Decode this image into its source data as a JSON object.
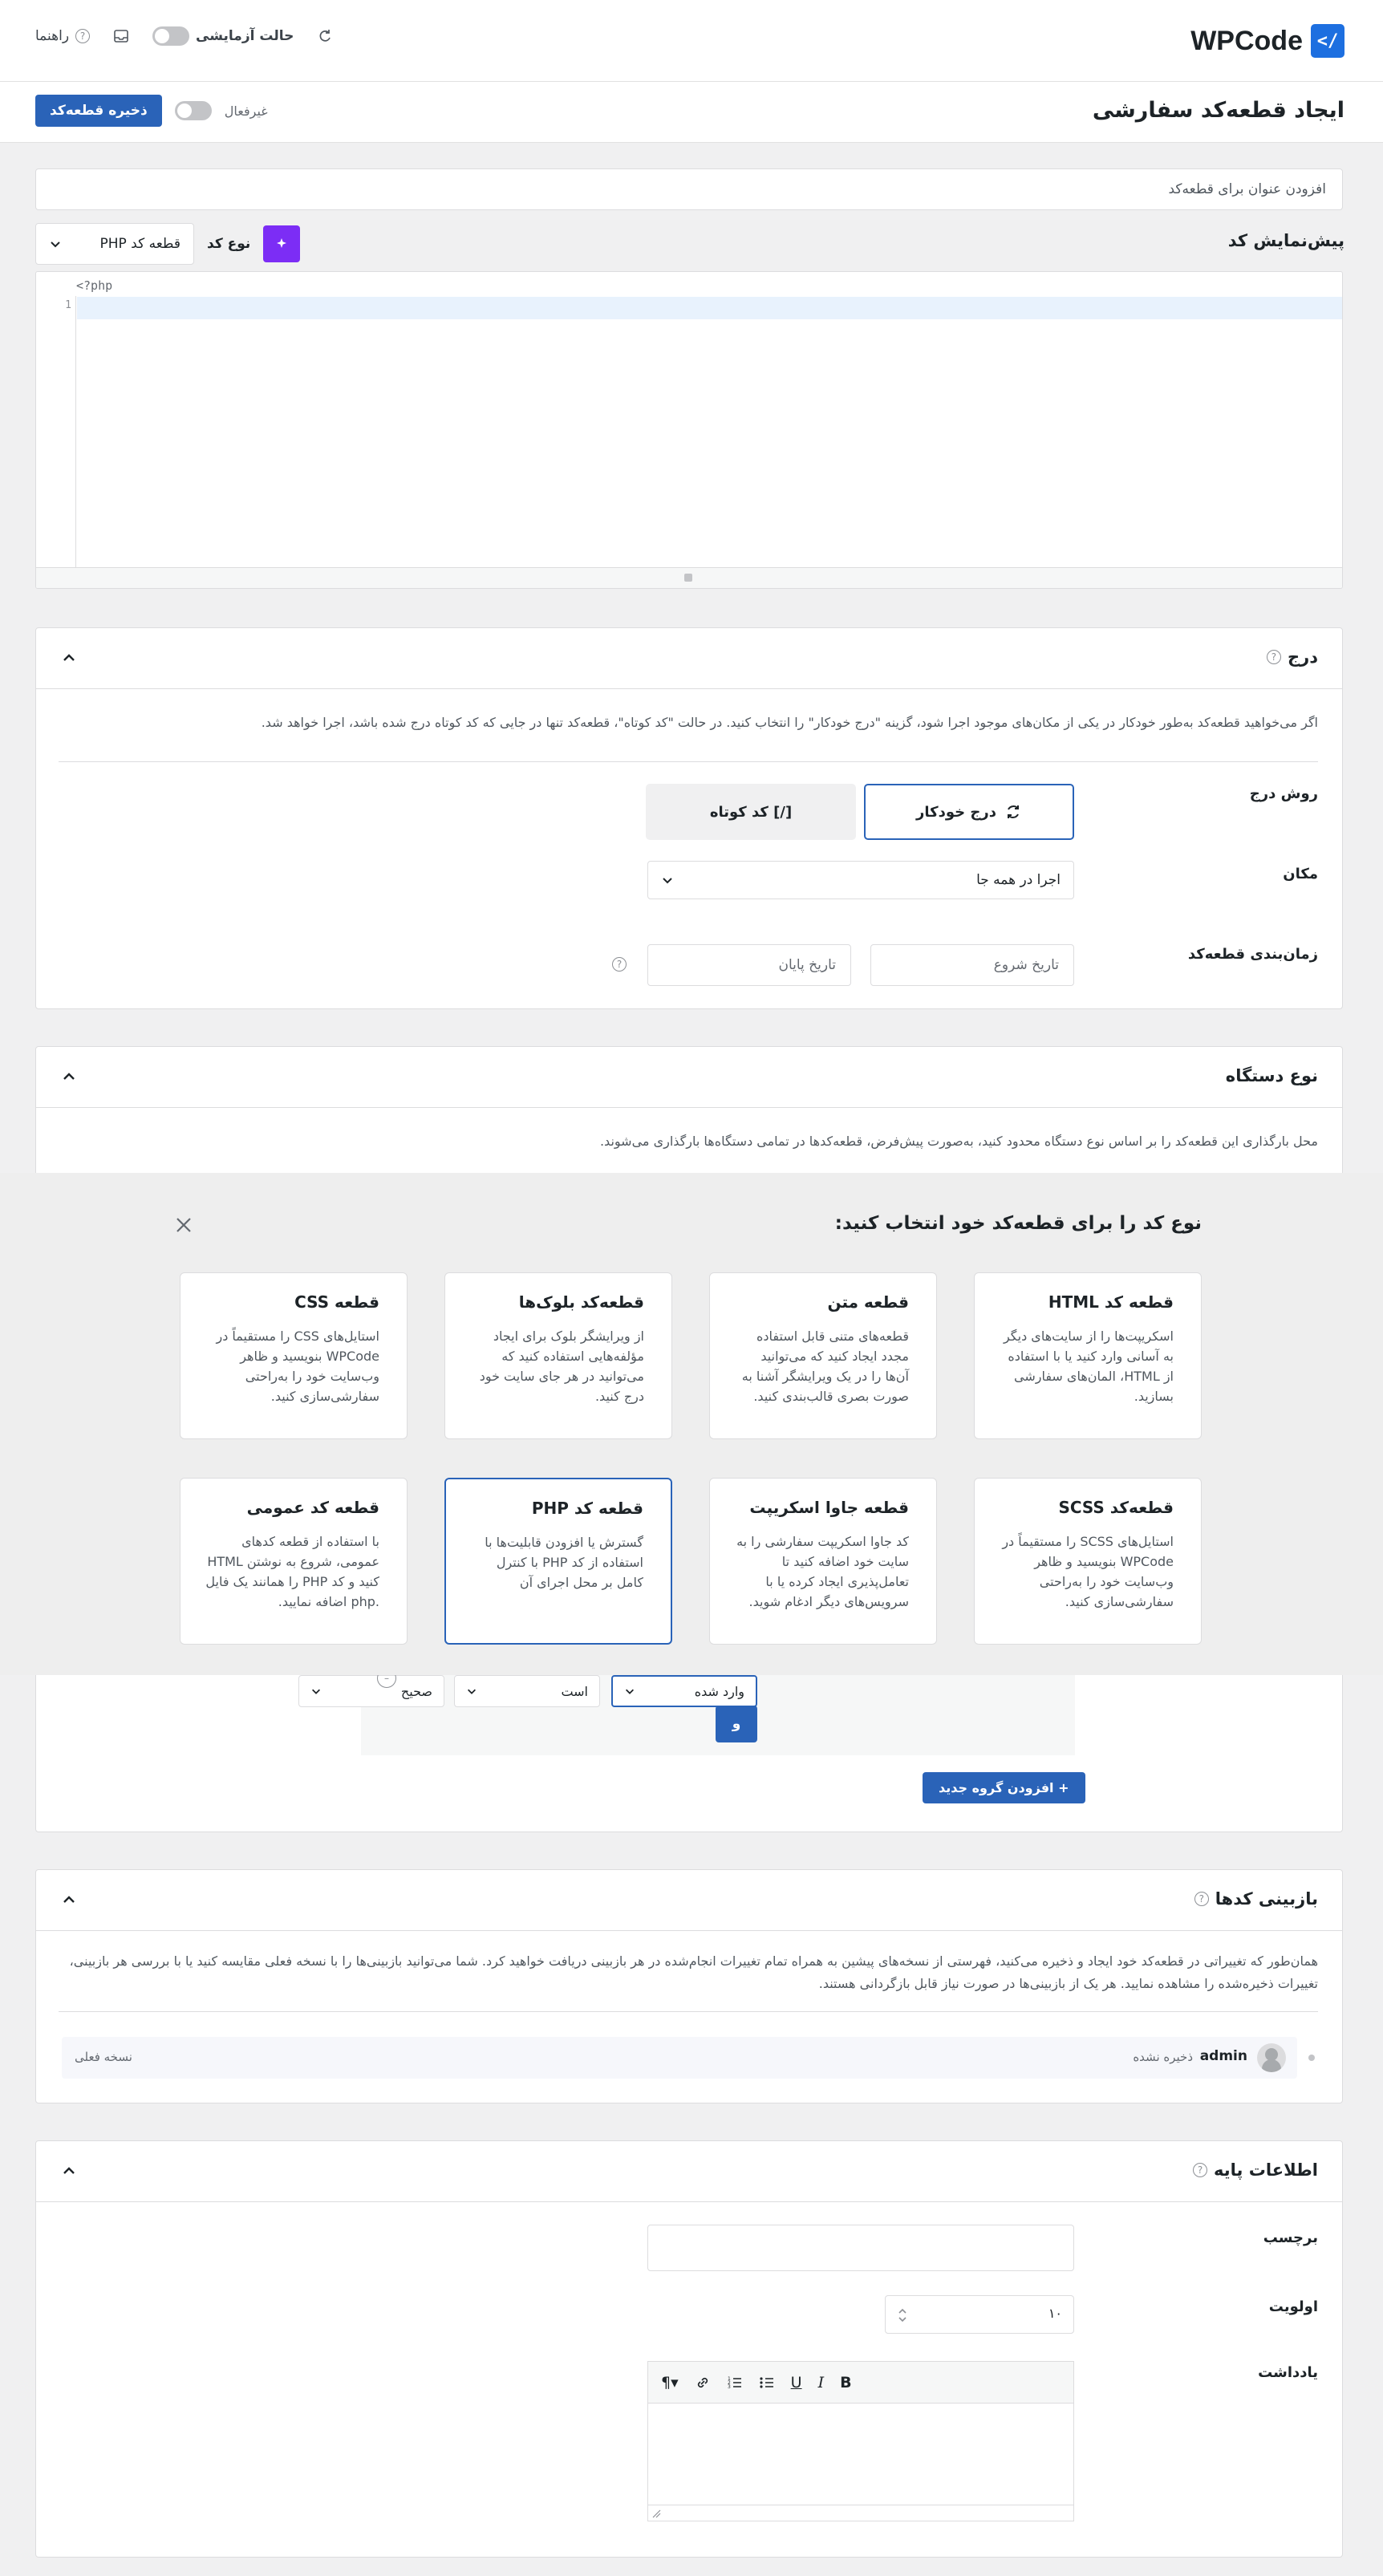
{
  "app": {
    "logo_mark": "/>",
    "logo_text": "WPCode"
  },
  "topbar": {
    "help_label": "راهنما",
    "test_mode_label": "حالت آزمایشی"
  },
  "header": {
    "title": "ایجاد قطعه‌کد سفارشی",
    "save_label": "ذخیره قطعه‌کد",
    "status_label": "غیرفعال"
  },
  "editor_section": {
    "title_placeholder": "افزودن عنوان برای قطعه‌کد",
    "preview_heading": "پیش‌نمایش کد",
    "code_type_label": "نوع کد",
    "code_type_value": "قطعه کد PHP",
    "first_line": "<?php",
    "line_number": "1"
  },
  "insertion": {
    "title": "درج",
    "description": "اگر می‌خواهید قطعه‌کد به‌طور خودکار در یکی از مکان‌های موجود اجرا شود، گزینه \"درج خودکار\" را انتخاب کنید. در حالت \"کد کوتاه\"، قطعه‌کد تنها در جایی که کد کوتاه درج شده باشد، اجرا خواهد شد.",
    "method_label": "روش درج",
    "auto_insert_label": "درج خودکار",
    "shortcode_label": "[/] کد کوتاه",
    "location_label": "مکان",
    "location_value": "اجرا در همه جا",
    "schedule_label": "زمان‌بندی قطعه‌کد",
    "start_date_placeholder": "تاریخ شروع",
    "end_date_placeholder": "تاریخ پایان"
  },
  "device_type": {
    "title": "نوع دستگاه",
    "description": "محل بارگذاری این قطعه‌کد را بر اساس نوع دستگاه محدود کنید، به‌صورت پیش‌فرض، قطعه‌کدها در تمامی دستگاه‌ها بارگذاری می‌شوند."
  },
  "modal": {
    "title": "نوع کد را برای قطعه‌کد خود انتخاب کنید:",
    "cards": [
      {
        "title": "قطعه کد HTML",
        "desc": "اسکریپت‌ها را از سایت‌های دیگر به آسانی وارد کنید یا با استفاده از HTML، المان‌های سفارشی بسازید."
      },
      {
        "title": "قطعه متن",
        "desc": "قطعه‌های متنی قابل استفاده مجدد ایجاد کنید که می‌توانید آن‌ها را در یک ویرایشگر آشنا به صورت بصری قالب‌بندی کنید."
      },
      {
        "title": "قطعه‌کد بلوک‌ها",
        "desc": "از ویرایشگر بلوک برای ایجاد مؤلفه‌هایی استفاده کنید که می‌توانید در هر جای سایت خود درج کنید."
      },
      {
        "title": "قطعه CSS",
        "desc": "استایل‌های CSS را مستقیماً در WPCode بنویسید و ظاهر وب‌سایت خود را به‌راحتی سفارشی‌سازی کنید."
      },
      {
        "title": "قطعه‌کد SCSS",
        "desc": "استایل‌های SCSS را مستقیماً در WPCode بنویسید و ظاهر وب‌سایت خود را به‌راحتی سفارشی‌سازی کنید."
      },
      {
        "title": "قطعه جاوا اسکریپت",
        "desc": "کد جاوا اسکریپت سفارشی را به سایت خود اضافه کنید تا تعامل‌پذیری ایجاد کرده یا با سرویس‌های دیگر ادغام شوید."
      },
      {
        "title": "قطعه کد PHP",
        "desc": "گسترش یا افزودن قابلیت‌ها با استفاده از کد PHP با کنترل کامل بر محل اجرای آن"
      },
      {
        "title": "قطعه کد عمومی",
        "desc": "با استفاده از قطعه کدهای عمومی، شروع به نوشتن HTML کنید و کد PHP را همانند یک فایل .php اضافه نمایید."
      }
    ]
  },
  "conditional": {
    "select_1": "وارد شده",
    "select_2": "است",
    "select_3": "صحیح",
    "and_label": "و",
    "add_group_label": "+ افزودن گروه جدید"
  },
  "revisions": {
    "title": "بازبینی کدها",
    "description": "همان‌طور که تغییراتی در قطعه‌کد خود ایجاد و ذخیره می‌کنید، فهرستی از نسخه‌های پیشین به همراه تمام تغییرات انجام‌شده در هر بازبینی دریافت خواهید کرد. شما می‌توانید بازبینی‌ها را با نسخه فعلی مقایسه کنید یا با بررسی هر بازبینی، تغییرات ذخیره‌شده را مشاهده نمایید. هر یک از بازبینی‌ها در صورت نیاز قابل بازگردانی هستند.",
    "user": "admin",
    "status": "ذخیره نشده",
    "current_label": "نسخه فعلی"
  },
  "basic_info": {
    "title": "اطلاعات پایه",
    "tag_label": "برچسب",
    "priority_label": "اولویت",
    "priority_value": "۱۰",
    "note_label": "یادداشت"
  },
  "colors": {
    "primary": "#2a63b8",
    "accent_purple": "#7c2df5"
  }
}
